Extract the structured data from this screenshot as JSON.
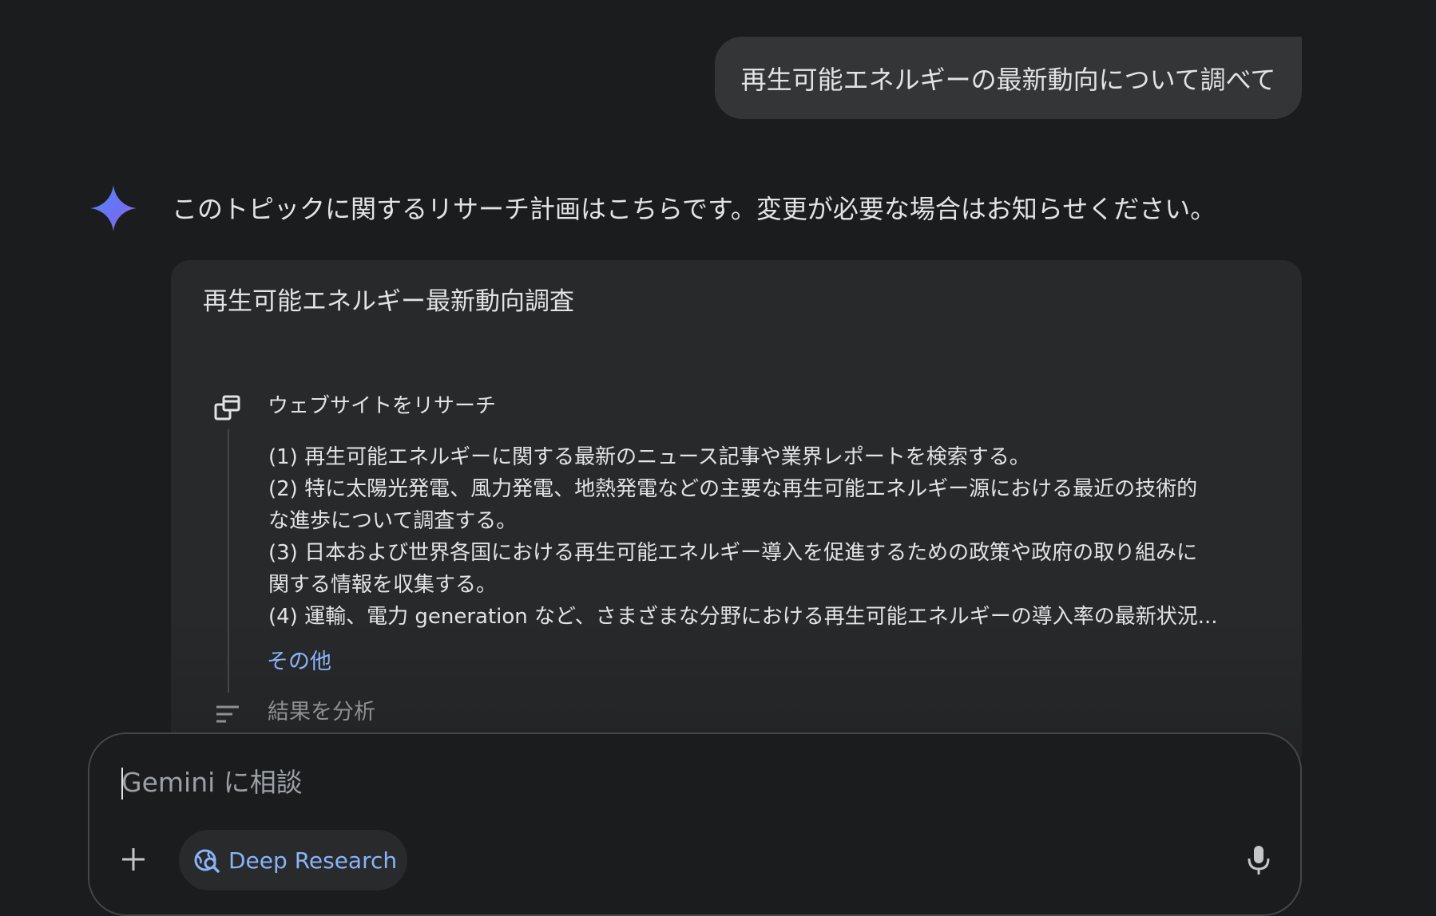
{
  "user_message": "再生可能エネルギーの最新動向について調べて",
  "assistant": {
    "intro": "このトピックに関するリサーチ計画はこちらです。変更が必要な場合はお知らせください。",
    "plan": {
      "title": "再生可能エネルギー最新動向調査",
      "research_step": {
        "label": "ウェブサイトをリサーチ",
        "lines": [
          "(1) 再生可能エネルギーに関する最新のニュース記事や業界レポートを検索する。",
          "(2) 特に太陽光発電、風力発電、地熱発電などの主要な再生可能エネルギー源における最近の技術的",
          "な進歩について調査する。",
          "(3) 日本および世界各国における再生可能エネルギー導入を促進するための政策や政府の取り組みに",
          "関する情報を収集する。",
          "(4) 運輸、電力 generation など、さまざまな分野における再生可能エネルギーの導入率の最新状況..."
        ],
        "more_label": "その他"
      },
      "analyze_step": {
        "label": "結果を分析"
      }
    }
  },
  "input": {
    "placeholder": "Gemini に相談",
    "chip_label": "Deep Research"
  },
  "colors": {
    "background": "#1b1c1d",
    "card": "#28292b",
    "bubble": "#333537",
    "accent": "#8ab4f8",
    "muted": "#8e918f"
  },
  "icons": {
    "assistant": "gemini-spark-icon",
    "research": "browse-web-icon",
    "analyze": "analyze-lines-icon",
    "add": "plus-icon",
    "chip": "deep-research-icon",
    "voice": "microphone-icon"
  }
}
